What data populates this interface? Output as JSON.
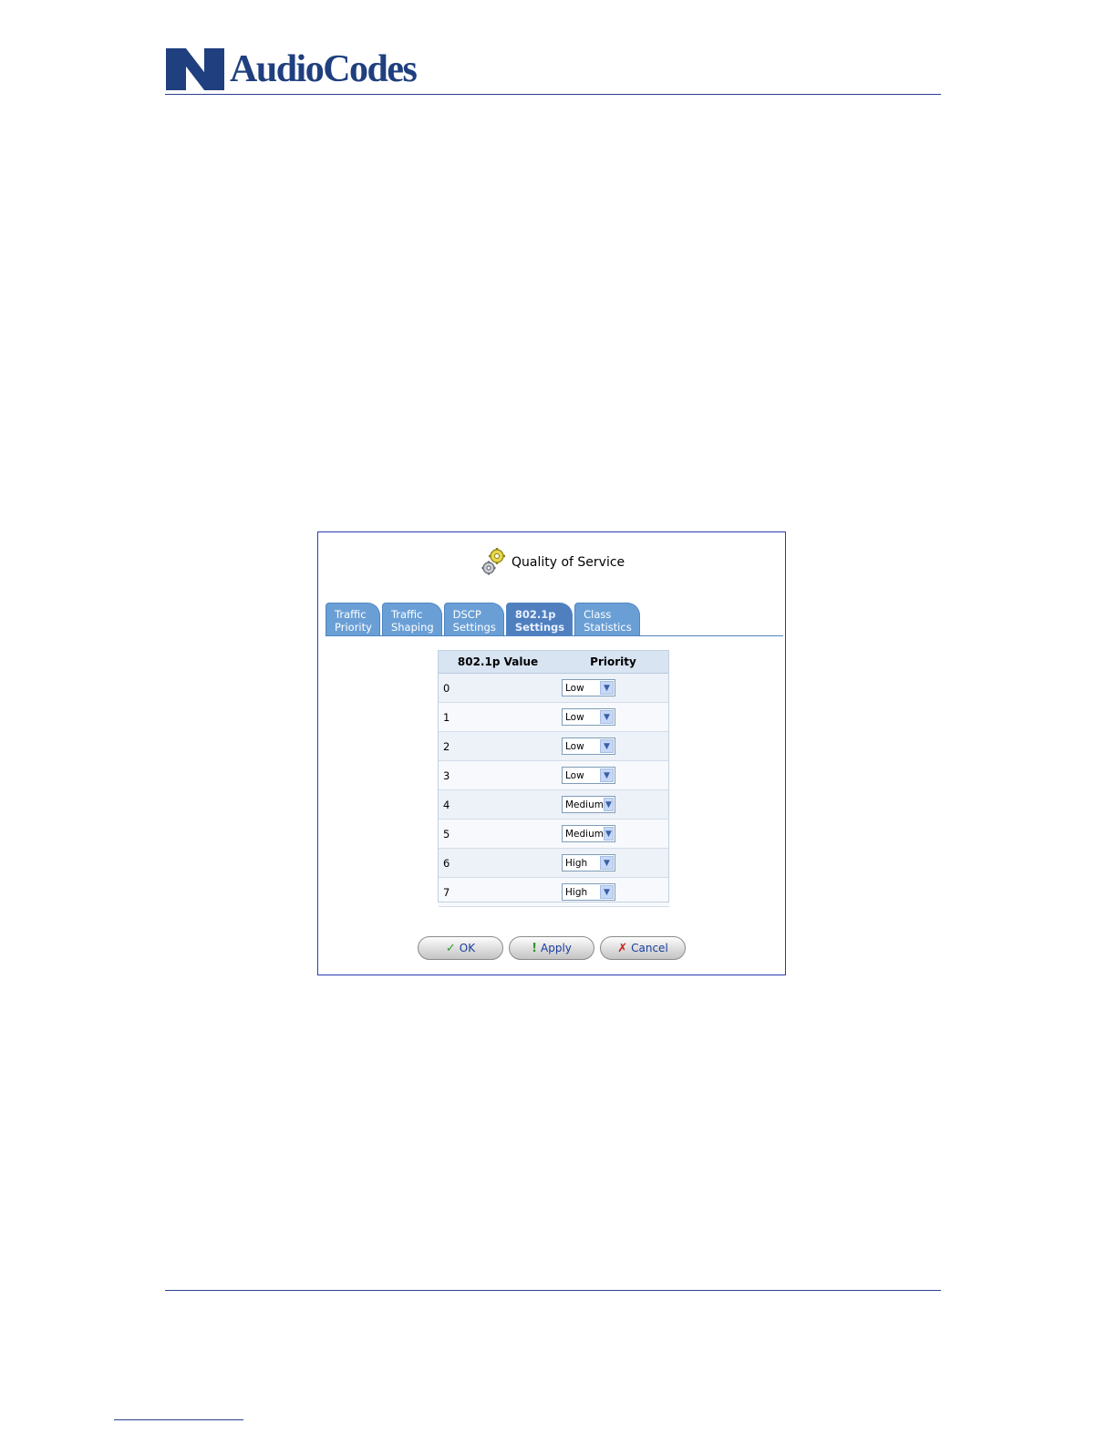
{
  "header": {
    "logo_text": "AudioCodes"
  },
  "qos": {
    "title": "Quality of Service",
    "tabs": [
      {
        "line1": "Traffic",
        "line2": "Priority",
        "active": false
      },
      {
        "line1": "Traffic",
        "line2": "Shaping",
        "active": false
      },
      {
        "line1": "DSCP",
        "line2": "Settings",
        "active": false
      },
      {
        "line1": "802.1p",
        "line2": "Settings",
        "active": true
      },
      {
        "line1": "Class",
        "line2": "Statistics",
        "active": false
      }
    ],
    "table": {
      "headers": [
        "802.1p Value",
        "Priority"
      ],
      "rows": [
        {
          "value": "0",
          "priority": "Low"
        },
        {
          "value": "1",
          "priority": "Low"
        },
        {
          "value": "2",
          "priority": "Low"
        },
        {
          "value": "3",
          "priority": "Low"
        },
        {
          "value": "4",
          "priority": "Medium"
        },
        {
          "value": "5",
          "priority": "Medium"
        },
        {
          "value": "6",
          "priority": "High"
        },
        {
          "value": "7",
          "priority": "High"
        }
      ]
    },
    "buttons": {
      "ok": "OK",
      "apply": "Apply",
      "cancel": "Cancel"
    }
  }
}
